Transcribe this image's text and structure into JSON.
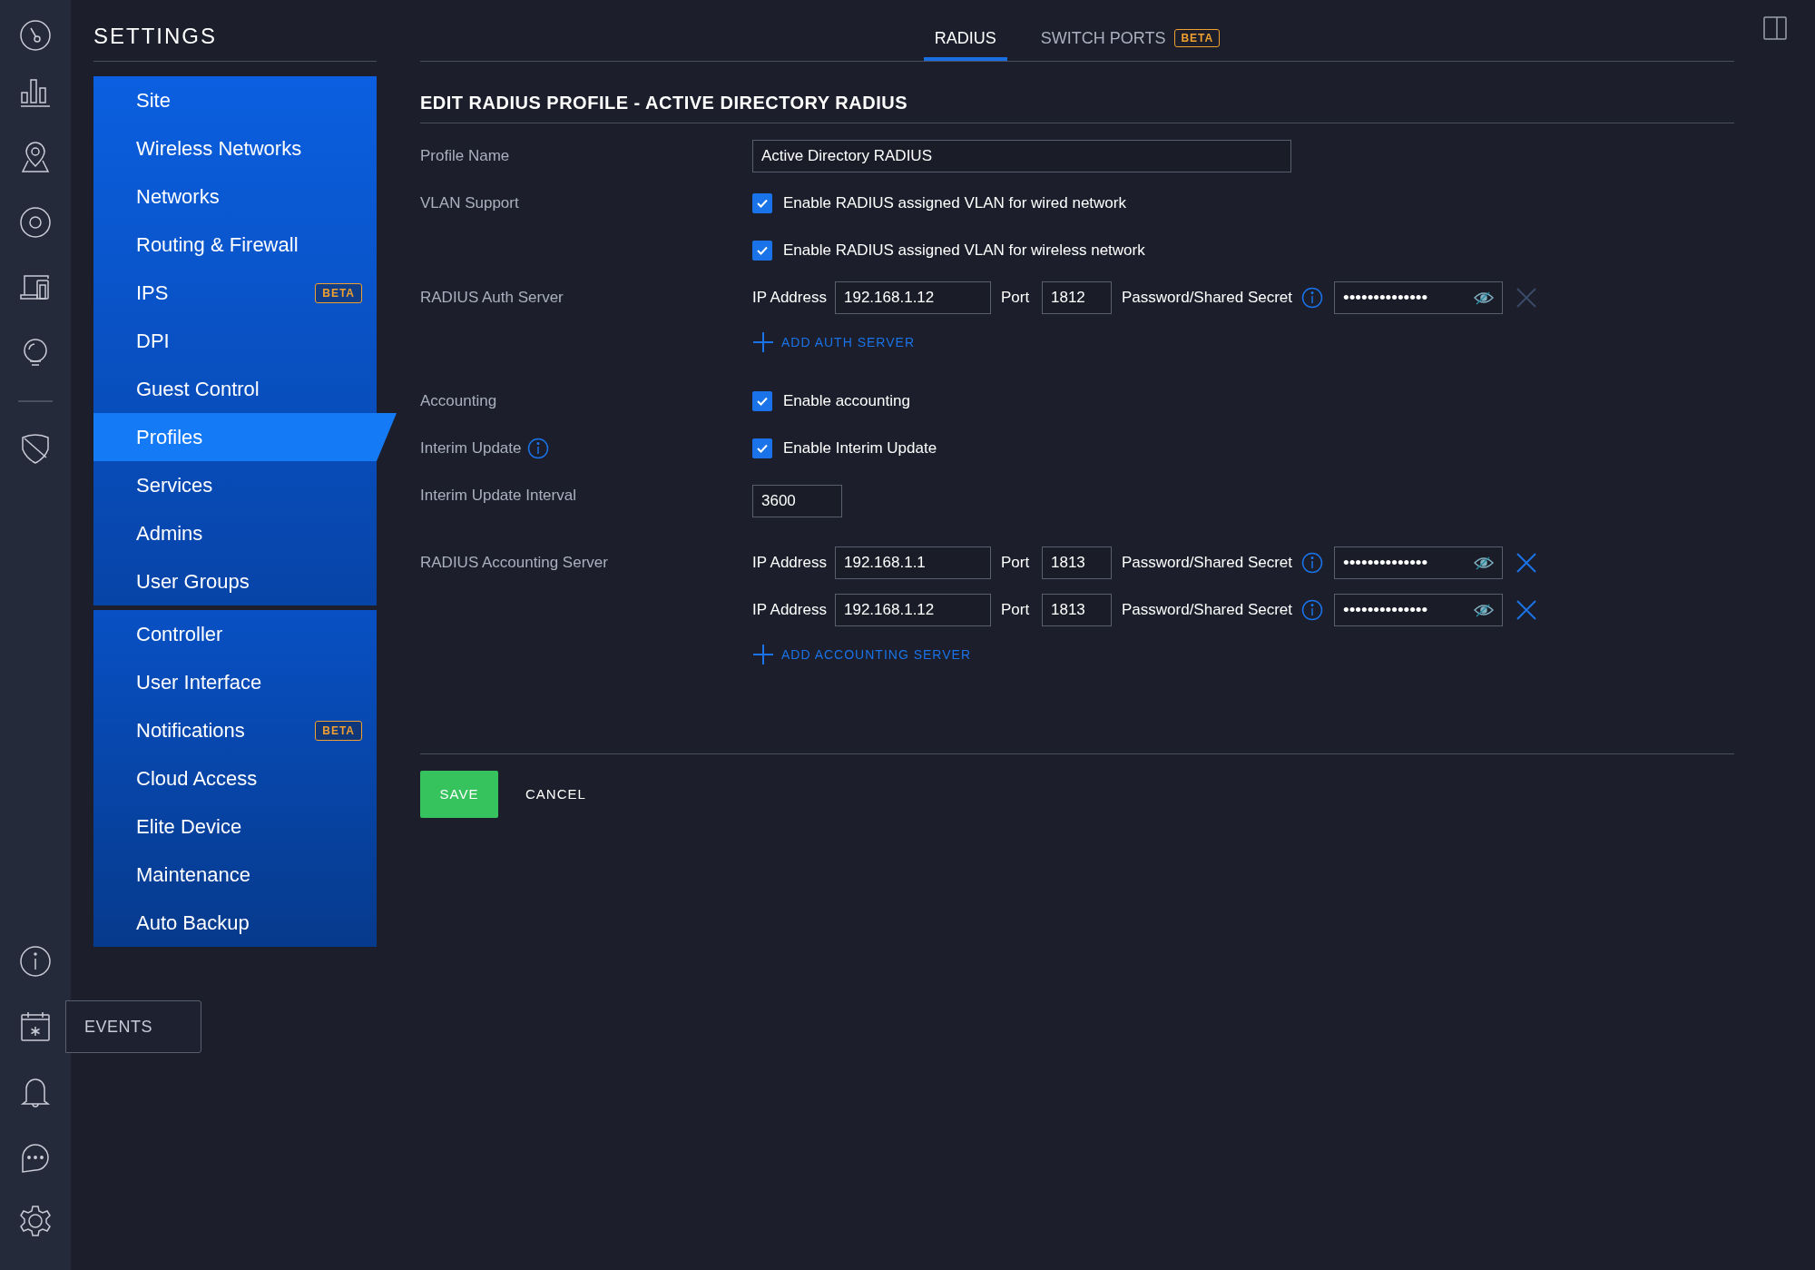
{
  "rail": {
    "tooltip": "EVENTS"
  },
  "sidebar": {
    "title": "SETTINGS",
    "groups": [
      [
        {
          "label": "Site",
          "selected": false
        },
        {
          "label": "Wireless Networks",
          "selected": false
        },
        {
          "label": "Networks",
          "selected": false
        },
        {
          "label": "Routing & Firewall",
          "selected": false
        },
        {
          "label": "IPS",
          "selected": false,
          "badge": "BETA"
        },
        {
          "label": "DPI",
          "selected": false
        },
        {
          "label": "Guest Control",
          "selected": false
        },
        {
          "label": "Profiles",
          "selected": true
        },
        {
          "label": "Services",
          "selected": false
        },
        {
          "label": "Admins",
          "selected": false
        },
        {
          "label": "User Groups",
          "selected": false
        }
      ],
      [
        {
          "label": "Controller",
          "selected": false
        },
        {
          "label": "User Interface",
          "selected": false
        },
        {
          "label": "Notifications",
          "selected": false,
          "badge": "BETA"
        },
        {
          "label": "Cloud Access",
          "selected": false
        },
        {
          "label": "Elite Device",
          "selected": false
        },
        {
          "label": "Maintenance",
          "selected": false
        },
        {
          "label": "Auto Backup",
          "selected": false
        }
      ]
    ]
  },
  "tabs": [
    {
      "label": "RADIUS",
      "selected": true
    },
    {
      "label": "SWITCH PORTS",
      "selected": false,
      "badge": "BETA"
    }
  ],
  "form": {
    "title": "EDIT RADIUS PROFILE - ACTIVE DIRECTORY RADIUS",
    "rows": [
      {
        "kind": "text",
        "label": "Profile Name",
        "value": "Active Directory RADIUS"
      },
      {
        "kind": "checks",
        "label": "VLAN Support",
        "options": [
          {
            "text": "Enable RADIUS assigned VLAN for wired network",
            "checked": true
          },
          {
            "text": "Enable RADIUS assigned VLAN for wireless network",
            "checked": true
          }
        ]
      },
      {
        "kind": "servers",
        "label": "RADIUS Auth Server",
        "servers": [
          {
            "ip_label": "IP Address",
            "ip": "192.168.1.12",
            "port_label": "Port",
            "port": "1812",
            "secret_label": "Password/Shared Secret",
            "secret": "••••••••••••••",
            "removable": false
          }
        ],
        "add_label": "ADD AUTH SERVER"
      },
      {
        "kind": "checks",
        "label": "Accounting",
        "options": [
          {
            "text": "Enable accounting",
            "checked": true
          }
        ]
      },
      {
        "kind": "checks",
        "label": "Interim Update",
        "info": true,
        "options": [
          {
            "text": "Enable Interim Update",
            "checked": true
          }
        ]
      },
      {
        "kind": "short_text",
        "label": "Interim Update Interval",
        "value": "3600"
      },
      {
        "kind": "servers",
        "label": "RADIUS Accounting Server",
        "servers": [
          {
            "ip_label": "IP Address",
            "ip": "192.168.1.1",
            "port_label": "Port",
            "port": "1813",
            "secret_label": "Password/Shared Secret",
            "secret": "••••••••••••••",
            "removable": true
          },
          {
            "ip_label": "IP Address",
            "ip": "192.168.1.12",
            "port_label": "Port",
            "port": "1813",
            "secret_label": "Password/Shared Secret",
            "secret": "••••••••••••••",
            "removable": true
          }
        ],
        "add_label": "ADD ACCOUNTING SERVER"
      }
    ]
  },
  "buttons": {
    "save": "SAVE",
    "cancel": "CANCEL"
  }
}
